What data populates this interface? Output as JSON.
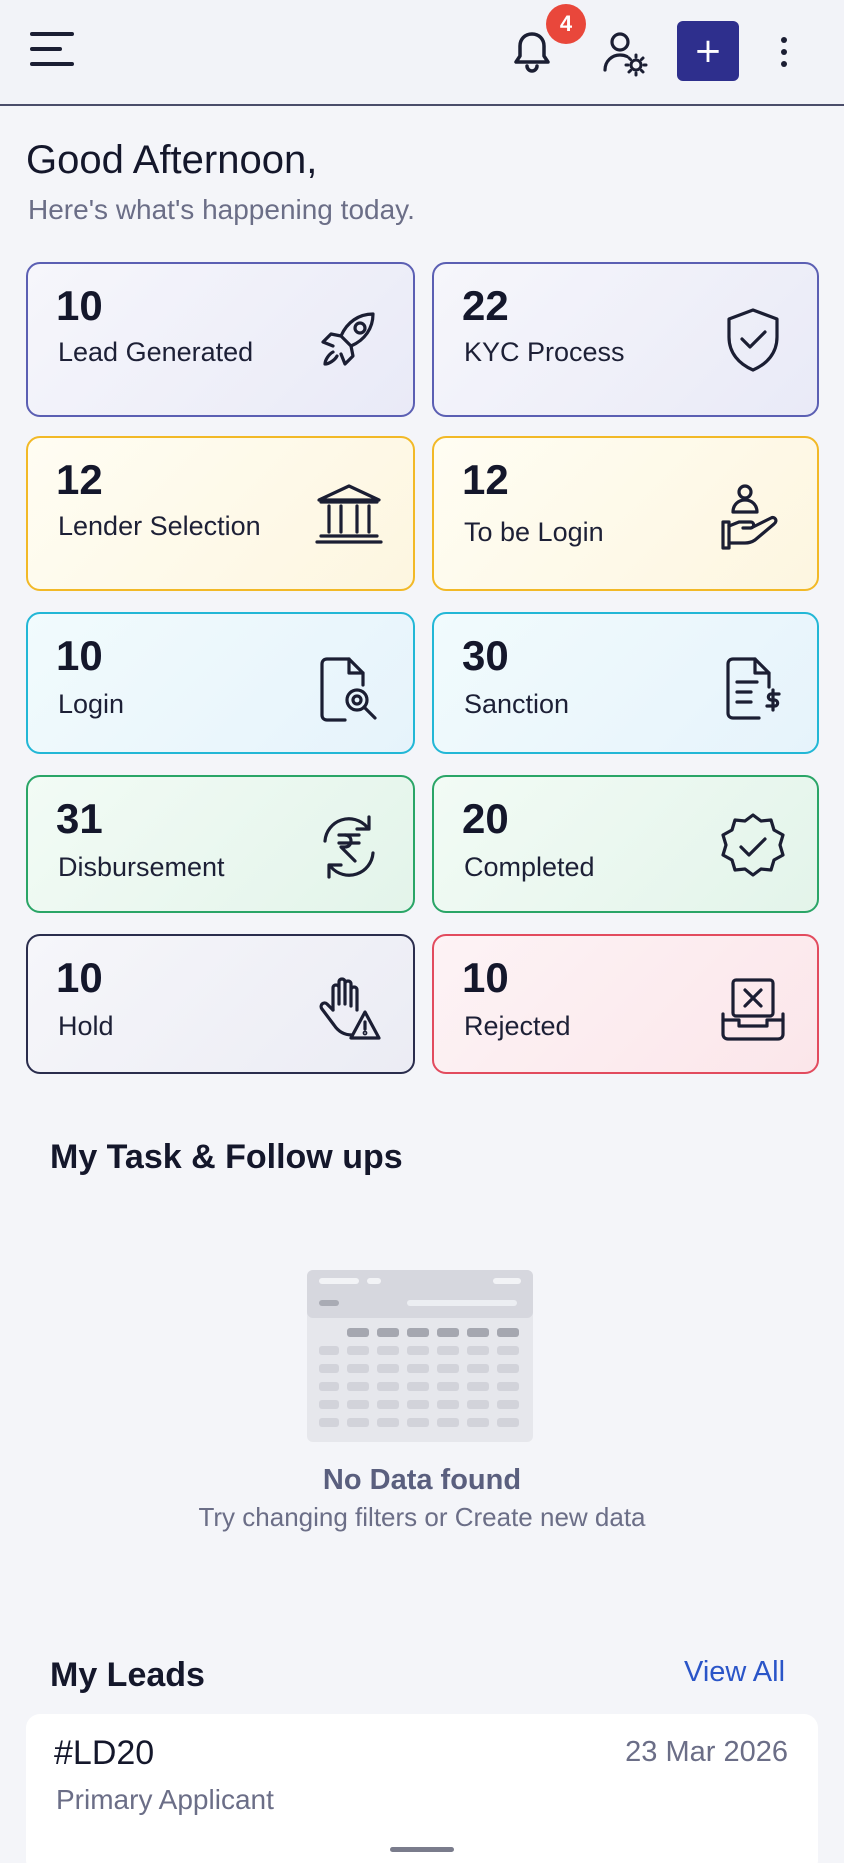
{
  "header": {
    "notification_count": "4",
    "add_label": "+"
  },
  "greeting": {
    "title": "Good Afternoon,",
    "subtitle": "Here's what's happening today."
  },
  "stats": [
    {
      "count": "10",
      "label": "Lead Generated",
      "icon": "rocket-icon",
      "color": "#5b5fb3"
    },
    {
      "count": "22",
      "label": "KYC Process",
      "icon": "shield-check-icon",
      "color": "#5b5fb3"
    },
    {
      "count": "12",
      "label": "Lender Selection",
      "icon": "bank-icon",
      "color": "#f2b927"
    },
    {
      "count": "12",
      "label": "To be Login",
      "icon": "hand-user-icon",
      "color": "#f2b927"
    },
    {
      "count": "10",
      "label": "Login",
      "icon": "document-search-icon",
      "color": "#22b7d6"
    },
    {
      "count": "30",
      "label": "Sanction",
      "icon": "document-dollar-icon",
      "color": "#22b7d6"
    },
    {
      "count": "31",
      "label": "Disbursement",
      "icon": "rupee-cycle-icon",
      "color": "#2aa567"
    },
    {
      "count": "20",
      "label": "Completed",
      "icon": "badge-check-icon",
      "color": "#2aa567"
    },
    {
      "count": "10",
      "label": "Hold",
      "icon": "hand-warning-icon",
      "color": "#2a2d4d"
    },
    {
      "count": "10",
      "label": "Rejected",
      "icon": "box-x-icon",
      "color": "#e24b5e"
    }
  ],
  "tasks": {
    "title": "My Task & Follow ups",
    "empty_title": "No Data found",
    "empty_subtitle": "Try changing filters or Create new data"
  },
  "leads": {
    "title": "My Leads",
    "view_all": "View All",
    "items": [
      {
        "id": "#LD20",
        "date": "23 Mar 2026",
        "role": "Primary Applicant"
      }
    ]
  }
}
